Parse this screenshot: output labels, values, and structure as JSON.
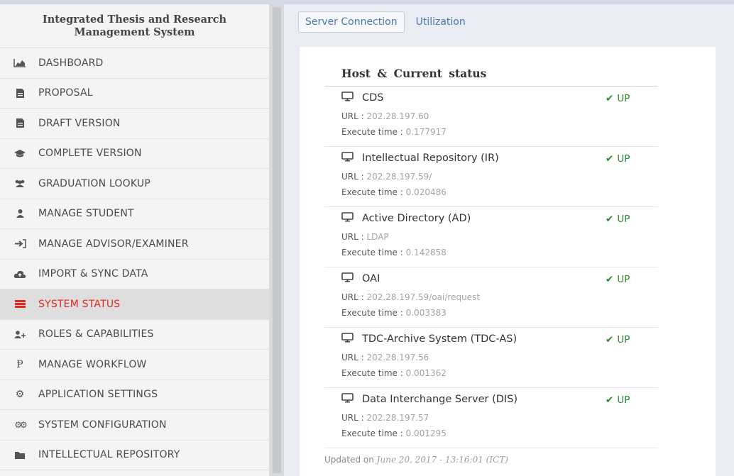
{
  "app": {
    "title": "Integrated Thesis and Research Management System"
  },
  "sidebar": {
    "items": [
      {
        "label": "DASHBOARD",
        "icon": "area-chart-icon"
      },
      {
        "label": "PROPOSAL",
        "icon": "document-icon"
      },
      {
        "label": "DRAFT VERSION",
        "icon": "document-icon"
      },
      {
        "label": "COMPLETE VERSION",
        "icon": "graduation-cap-icon"
      },
      {
        "label": "GRADUATION LOOKUP",
        "icon": "users-icon"
      },
      {
        "label": "MANAGE STUDENT",
        "icon": "user-icon"
      },
      {
        "label": "MANAGE ADVISOR/EXAMINER",
        "icon": "sign-in-icon"
      },
      {
        "label": "IMPORT & SYNC DATA",
        "icon": "cloud-upload-icon"
      },
      {
        "label": "SYSTEM STATUS",
        "icon": "server-icon",
        "active": true
      },
      {
        "label": "ROLES & CAPABILITIES",
        "icon": "user-plus-icon"
      },
      {
        "label": "MANAGE WORKFLOW",
        "icon": "code-fork-icon"
      },
      {
        "label": "APPLICATION SETTINGS",
        "icon": "gear-icon"
      },
      {
        "label": "SYSTEM CONFIGURATION",
        "icon": "gears-icon"
      },
      {
        "label": "INTELLECTUAL REPOSITORY",
        "icon": "folder-icon"
      }
    ]
  },
  "tabs": [
    {
      "label": "Server Connection",
      "active": true
    },
    {
      "label": "Utilization",
      "active": false
    }
  ],
  "status_table": {
    "header": "Host & Current status",
    "url_label": "URL :",
    "exec_label": "Execute time :",
    "hosts": [
      {
        "name": "CDS",
        "status": "UP",
        "url": "202.28.197.60",
        "exec": "0.177917"
      },
      {
        "name": "Intellectual Repository (IR)",
        "status": "UP",
        "url": "202.28.197.59/",
        "exec": "0.020486"
      },
      {
        "name": "Active Directory (AD)",
        "status": "UP",
        "url": "LDAP",
        "exec": "0.142858"
      },
      {
        "name": "OAI",
        "status": "UP",
        "url": "202.28.197.59/oai/request",
        "exec": "0.003383"
      },
      {
        "name": "TDC-Archive System (TDC-AS)",
        "status": "UP",
        "url": "202.28.197.56",
        "exec": "0.001362"
      },
      {
        "name": "Data Interchange Server (DIS)",
        "status": "UP",
        "url": "202.28.197.57",
        "exec": "0.001295"
      }
    ],
    "updated_prefix": "Updated on",
    "updated_value": "June 20, 2017 - 13:16:01 (ICT)"
  },
  "colors": {
    "active_menu": "#e02a1f",
    "status_up": "#2a8a2a",
    "tab_link": "#4a77b5"
  }
}
